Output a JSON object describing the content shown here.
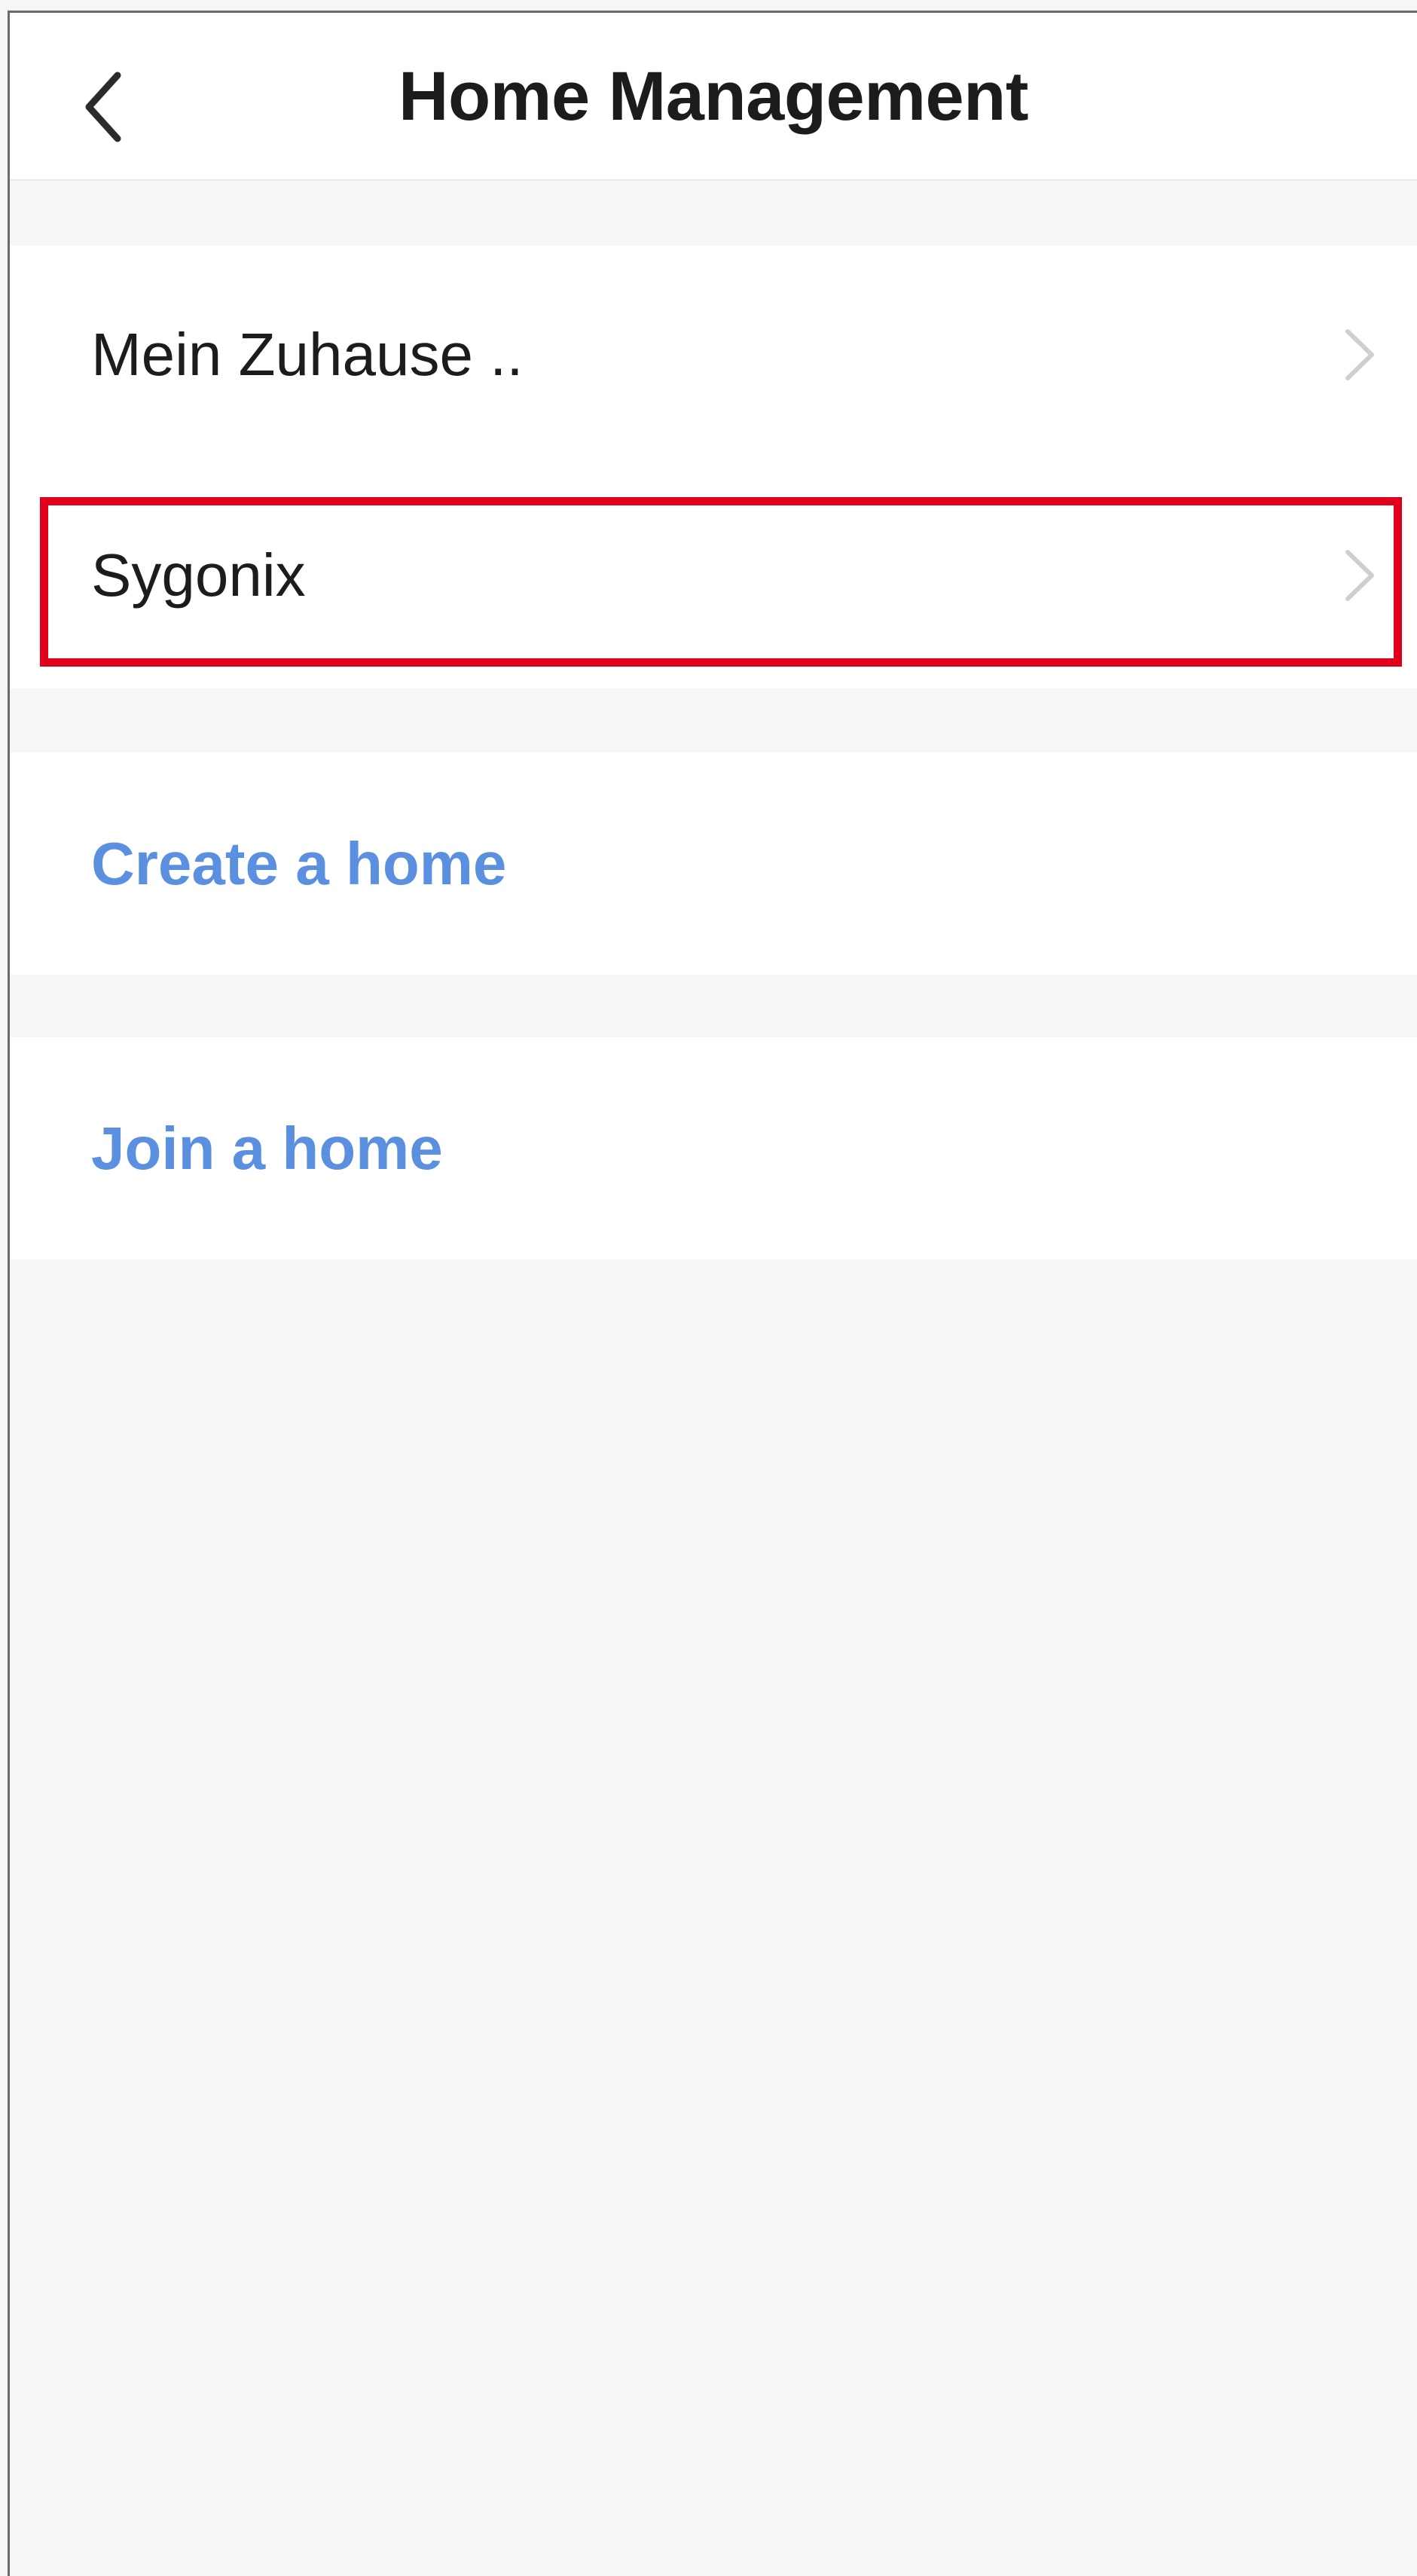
{
  "header": {
    "title": "Home Management",
    "back_icon": "chevron-left-icon"
  },
  "homes": {
    "items": [
      {
        "label": "Mein Zuhause ..",
        "icon": "chevron-right-icon"
      },
      {
        "label": "Sygonix",
        "icon": "chevron-right-icon",
        "highlighted": true
      }
    ]
  },
  "actions": {
    "create_label": "Create a home",
    "join_label": "Join a home"
  },
  "colors": {
    "background": "#f6f6f6",
    "card": "#ffffff",
    "title_text": "#1c1c1c",
    "action_text": "#5b8fe0",
    "chevron": "#cfcfcf",
    "highlight": "#e0001b"
  }
}
